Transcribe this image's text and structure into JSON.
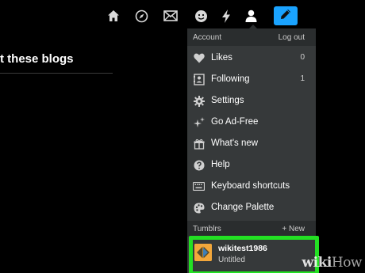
{
  "header": {
    "icons": [
      "home-icon",
      "explore-icon",
      "mail-icon",
      "activity-icon",
      "lightning-icon",
      "account-icon"
    ],
    "compose_icon": "pencil-icon",
    "compose_color": "#1aa3ff"
  },
  "background": {
    "heading": "t these blogs"
  },
  "account_menu": {
    "header_label": "Account",
    "logout_label": "Log out",
    "items": [
      {
        "label": "Likes",
        "count": "0",
        "icon": "heart-icon"
      },
      {
        "label": "Following",
        "count": "1",
        "icon": "following-icon"
      },
      {
        "label": "Settings",
        "icon": "gear-icon"
      },
      {
        "label": "Go Ad-Free",
        "icon": "sparkle-icon"
      },
      {
        "label": "What's new",
        "icon": "gift-icon"
      },
      {
        "label": "Help",
        "icon": "help-icon"
      },
      {
        "label": "Keyboard shortcuts",
        "icon": "keyboard-icon"
      },
      {
        "label": "Change Palette",
        "icon": "palette-icon"
      }
    ],
    "tumblrs_label": "Tumblrs",
    "new_label": "+ New",
    "blog": {
      "name": "wikitest1986",
      "subtitle": "Untitled",
      "avatar_color": "#f3a73b"
    },
    "highlight_color": "#23e023"
  },
  "watermark": {
    "brand": "wiki",
    "suffix": "How"
  }
}
